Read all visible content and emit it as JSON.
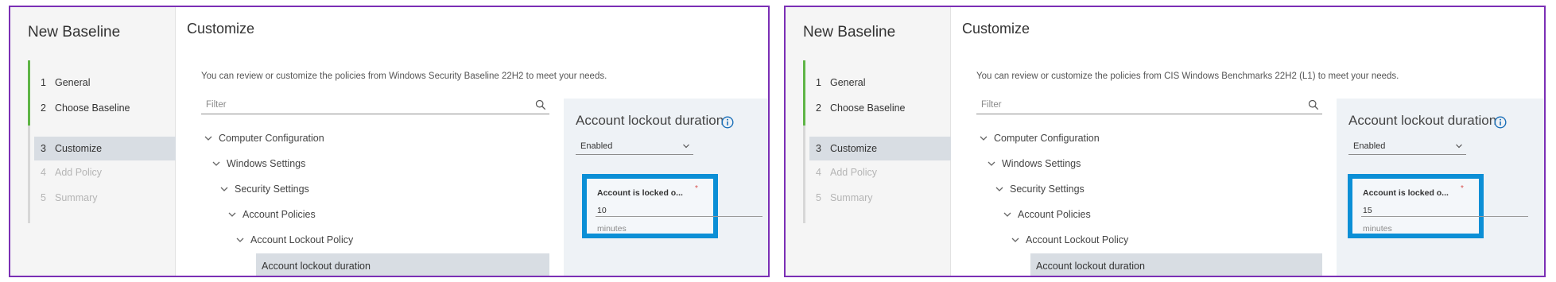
{
  "colors": {
    "frame": "#7b2fb5",
    "completed_rail": "#5fb546",
    "highlight_border": "#0b8fd6",
    "active_step_bg": "#d8dde3",
    "required": "#d9534f"
  },
  "panels": [
    {
      "sidebar": {
        "title": "New Baseline",
        "steps": [
          {
            "num": "1",
            "label": "General",
            "state": "completed"
          },
          {
            "num": "2",
            "label": "Choose Baseline",
            "state": "completed"
          },
          {
            "num": "3",
            "label": "Customize",
            "state": "active"
          },
          {
            "num": "4",
            "label": "Add Policy",
            "state": "disabled"
          },
          {
            "num": "5",
            "label": "Summary",
            "state": "disabled"
          }
        ]
      },
      "content": {
        "title": "Customize",
        "intro": "You can review or customize the policies from Windows Security Baseline 22H2 to meet your needs.",
        "filter_placeholder": "Filter",
        "tree": [
          {
            "label": "Computer Configuration",
            "icon": "chevron-down-icon"
          },
          {
            "label": "Windows Settings",
            "icon": "chevron-down-icon"
          },
          {
            "label": "Security Settings",
            "icon": "chevron-down-icon"
          },
          {
            "label": "Account Policies",
            "icon": "chevron-down-icon"
          },
          {
            "label": "Account Lockout Policy",
            "icon": "chevron-down-icon"
          },
          {
            "label": "Account lockout duration",
            "icon": ""
          }
        ],
        "detail": {
          "title": "Account lockout duration",
          "info_icon": "info-icon",
          "select_value": "Enabled",
          "field_label": "Account is locked o...",
          "required_mark": "*",
          "field_value": "10",
          "field_unit": "minutes"
        }
      }
    },
    {
      "sidebar": {
        "title": "New Baseline",
        "steps": [
          {
            "num": "1",
            "label": "General",
            "state": "completed"
          },
          {
            "num": "2",
            "label": "Choose Baseline",
            "state": "completed"
          },
          {
            "num": "3",
            "label": "Customize",
            "state": "active"
          },
          {
            "num": "4",
            "label": "Add Policy",
            "state": "disabled"
          },
          {
            "num": "5",
            "label": "Summary",
            "state": "disabled"
          }
        ]
      },
      "content": {
        "title": "Customize",
        "intro": "You can review or customize the policies from CIS Windows Benchmarks 22H2 (L1) to meet your needs.",
        "filter_placeholder": "Filter",
        "tree": [
          {
            "label": "Computer Configuration",
            "icon": "chevron-down-icon"
          },
          {
            "label": "Windows Settings",
            "icon": "chevron-down-icon"
          },
          {
            "label": "Security Settings",
            "icon": "chevron-down-icon"
          },
          {
            "label": "Account Policies",
            "icon": "chevron-down-icon"
          },
          {
            "label": "Account Lockout Policy",
            "icon": "chevron-down-icon"
          },
          {
            "label": "Account lockout duration",
            "icon": ""
          }
        ],
        "detail": {
          "title": "Account lockout duration",
          "info_icon": "info-icon",
          "select_value": "Enabled",
          "field_label": "Account is locked o...",
          "required_mark": "*",
          "field_value": "15",
          "field_unit": "minutes"
        }
      }
    }
  ]
}
